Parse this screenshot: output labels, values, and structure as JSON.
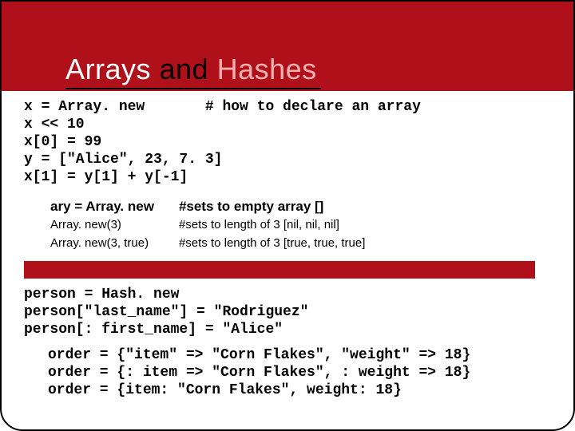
{
  "title": {
    "w1": "Arrays",
    "w2": " and ",
    "w3": "Hashes"
  },
  "code1": "x = Array. new       # how to declare an array\nx << 10\nx[0] = 99\ny = [\"Alice\", 23, 7. 3]\nx[1] = y[1] + y[-1]",
  "block2": {
    "row1_left": "ary = Array. new",
    "row1_right": "#sets to empty array  []",
    "row2_left": "Array. new(3)",
    "row2_right": "#sets to length of 3 [nil, nil, nil]",
    "row3_left": "Array. new(3, true)",
    "row3_right": "#sets to length of 3 [true, true, true]"
  },
  "code3": "person = Hash. new\nperson[\"last_name\"] = \"Rodriguez\"\nperson[: first_name] = \"Alice\"",
  "code4": "order = {\"item\" => \"Corn Flakes\", \"weight\" => 18}\norder = {: item => \"Corn Flakes\", : weight => 18}\norder = {item: \"Corn Flakes\", weight: 18}"
}
